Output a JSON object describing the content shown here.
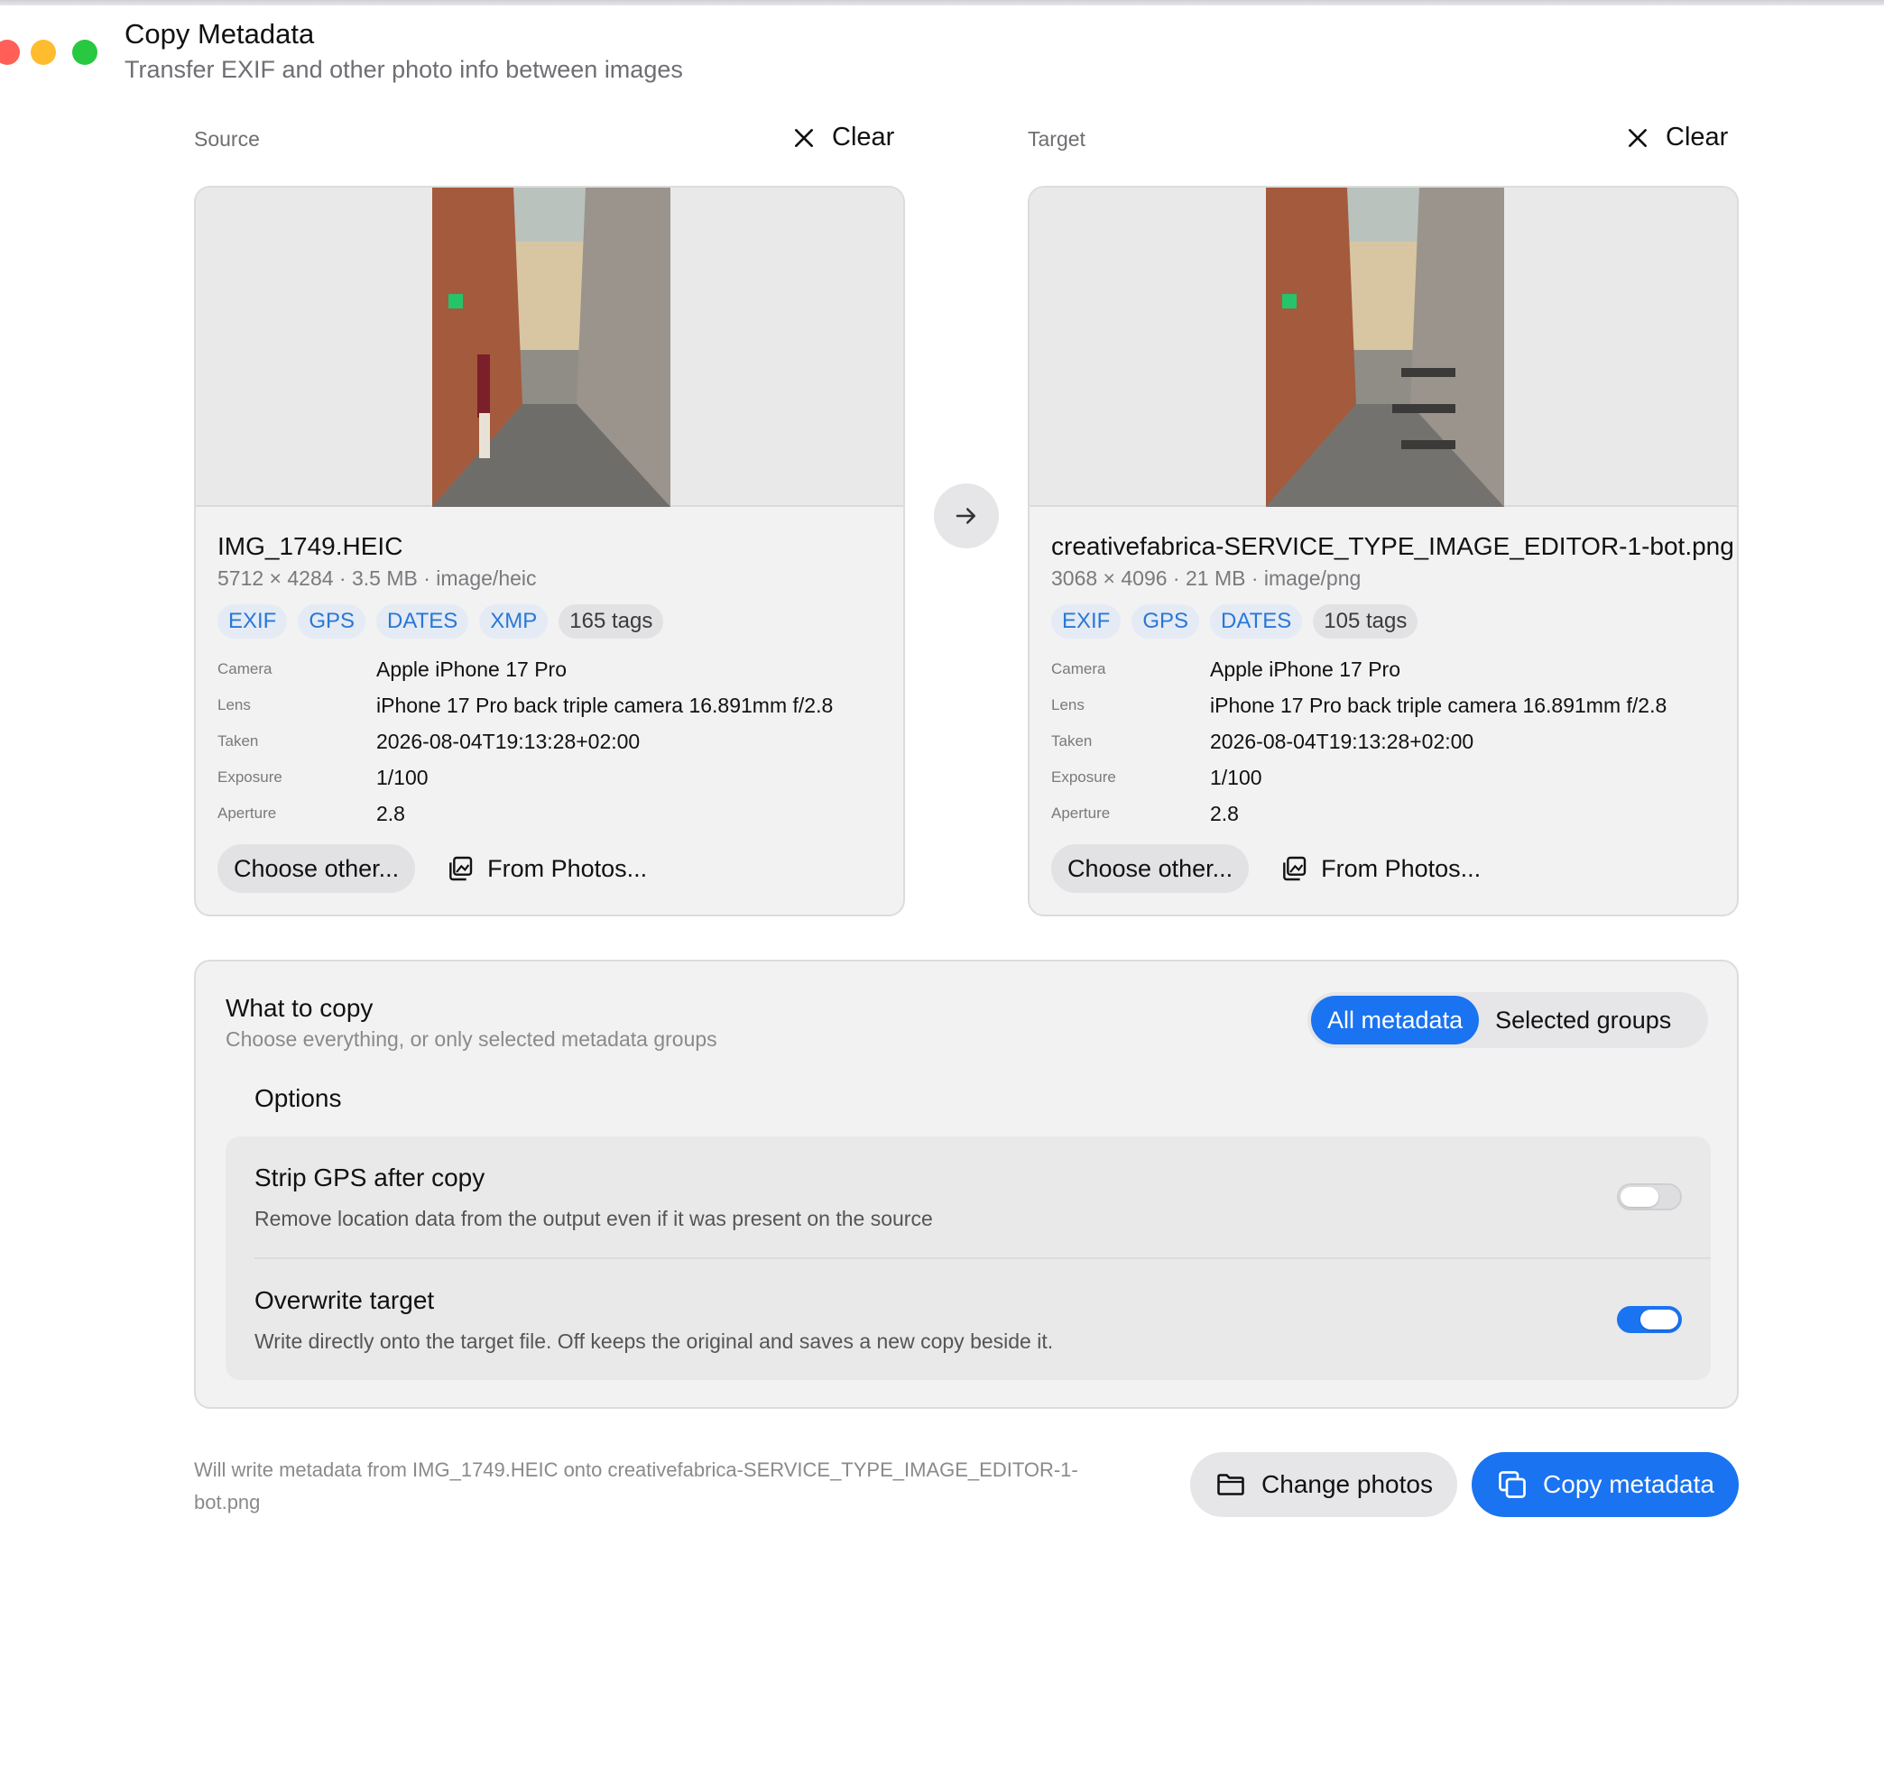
{
  "window": {
    "title": "Copy Metadata",
    "subtitle": "Transfer EXIF and other photo info between images"
  },
  "source": {
    "label": "Source",
    "clear_label": "Clear",
    "filename": "IMG_1749.HEIC",
    "file_info": "5712 × 4284 · 3.5 MB · image/heic",
    "chips": [
      "EXIF",
      "GPS",
      "DATES",
      "XMP"
    ],
    "tag_count": "165 tags",
    "meta": [
      {
        "key": "Camera",
        "value": "Apple iPhone 17 Pro"
      },
      {
        "key": "Lens",
        "value": "iPhone 17 Pro back triple camera 16.891mm f/2.8"
      },
      {
        "key": "Taken",
        "value": "2026-08-04T19:13:28+02:00"
      },
      {
        "key": "Exposure",
        "value": "1/100"
      },
      {
        "key": "Aperture",
        "value": "2.8"
      }
    ],
    "choose_label": "Choose other...",
    "photos_label": "From Photos..."
  },
  "target": {
    "label": "Target",
    "clear_label": "Clear",
    "filename": "creativefabrica-SERVICE_TYPE_IMAGE_EDITOR-1-bot.png",
    "file_info": "3068 × 4096 · 21 MB · image/png",
    "chips": [
      "EXIF",
      "GPS",
      "DATES"
    ],
    "tag_count": "105 tags",
    "meta": [
      {
        "key": "Camera",
        "value": "Apple iPhone 17 Pro"
      },
      {
        "key": "Lens",
        "value": "iPhone 17 Pro back triple camera 16.891mm f/2.8"
      },
      {
        "key": "Taken",
        "value": "2026-08-04T19:13:28+02:00"
      },
      {
        "key": "Exposure",
        "value": "1/100"
      },
      {
        "key": "Aperture",
        "value": "2.8"
      }
    ],
    "choose_label": "Choose other...",
    "photos_label": "From Photos..."
  },
  "what_to_copy": {
    "title": "What to copy",
    "subtitle": "Choose everything, or only selected metadata groups",
    "mode_options": [
      "All metadata",
      "Selected groups"
    ],
    "selected_mode": "All metadata",
    "options_title": "Options",
    "options": [
      {
        "name": "Strip GPS after copy",
        "description": "Remove location data from the output even if it was present on the source",
        "enabled": false
      },
      {
        "name": "Overwrite target",
        "description": "Write directly onto the target file. Off keeps the original and saves a new copy beside it.",
        "enabled": true
      }
    ]
  },
  "footer": {
    "note": "Will write metadata from IMG_1749.HEIC onto creativefabrica-SERVICE_TYPE_IMAGE_EDITOR-1-bot.png",
    "change_label": "Change photos",
    "copy_label": "Copy metadata"
  },
  "colors": {
    "accent": "#1a73f0",
    "chip_text": "#2a77d6",
    "traffic_red": "#ff5f57",
    "traffic_yellow": "#febc2e",
    "traffic_green": "#28c840"
  },
  "icons": [
    "close-icon",
    "arrow-right-icon",
    "photos-library-icon",
    "folder-icon",
    "copy-icon"
  ]
}
